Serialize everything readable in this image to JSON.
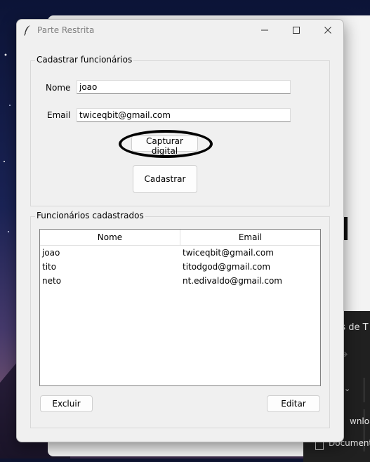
{
  "window": {
    "title": "Parte Restrita"
  },
  "register": {
    "group_title": "Cadastrar funcionários",
    "name_label": "Nome",
    "name_value": "joao",
    "email_label": "Email",
    "email_value": "twiceqbit@gmail.com",
    "capture_button": "Capturar digital",
    "submit_button": "Cadastrar"
  },
  "employees": {
    "group_title": "Funcionários cadastrados",
    "columns": [
      "Nome",
      "Email"
    ],
    "rows": [
      [
        "joao",
        "twiceqbit@gmail.com"
      ],
      [
        "tito",
        "titodgod@gmail.com"
      ],
      [
        "neto",
        "nt.edivaldo@gmail.com"
      ]
    ],
    "delete_button": "Excluir",
    "edit_button": "Editar"
  },
  "background_window": {
    "partial_title": "ras de T",
    "item1": "wnloads",
    "item2": "Documente"
  },
  "icons": {
    "app": "feather-icon",
    "minimize": "minimize-icon",
    "maximize": "maximize-icon",
    "close": "close-icon"
  }
}
